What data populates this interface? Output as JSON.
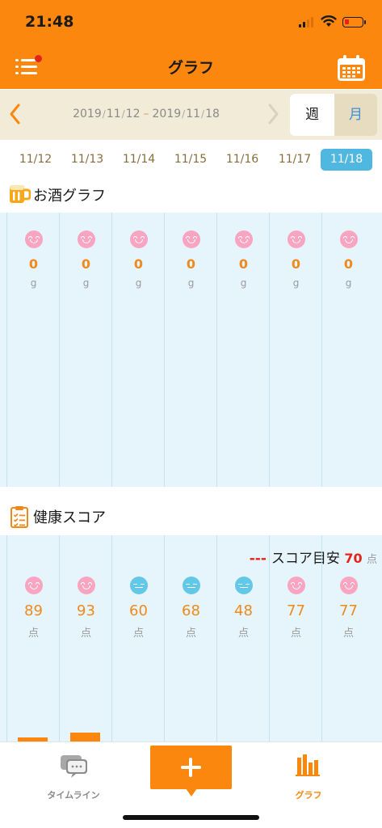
{
  "status": {
    "time": "21:48"
  },
  "header": {
    "title": "グラフ"
  },
  "range": {
    "start": {
      "y": "2019",
      "m": "11",
      "d": "12"
    },
    "end": {
      "y": "2019",
      "m": "11",
      "d": "18"
    },
    "sep": "/",
    "dash": "–"
  },
  "segments": {
    "week": "週",
    "month": "月",
    "selected": "週"
  },
  "days": [
    "11/12",
    "11/13",
    "11/14",
    "11/15",
    "11/16",
    "11/17",
    "11/18"
  ],
  "selected_day": "11/18",
  "alcohol": {
    "title": "お酒グラフ",
    "days": [
      {
        "mood": "happy",
        "value": "0",
        "unit": "g"
      },
      {
        "mood": "happy",
        "value": "0",
        "unit": "g"
      },
      {
        "mood": "happy",
        "value": "0",
        "unit": "g"
      },
      {
        "mood": "happy",
        "value": "0",
        "unit": "g"
      },
      {
        "mood": "happy",
        "value": "0",
        "unit": "g"
      },
      {
        "mood": "happy",
        "value": "0",
        "unit": "g"
      },
      {
        "mood": "happy",
        "value": "0",
        "unit": "g"
      }
    ]
  },
  "health": {
    "title": "健康スコア",
    "target_dashes": "---",
    "target_label": "スコア目安",
    "target_value": "70",
    "target_unit": "点",
    "days": [
      {
        "mood": "happy",
        "value": "89",
        "unit": "点"
      },
      {
        "mood": "happy",
        "value": "93",
        "unit": "点"
      },
      {
        "mood": "neutral",
        "value": "60",
        "unit": "点"
      },
      {
        "mood": "neutral",
        "value": "68",
        "unit": "点"
      },
      {
        "mood": "neutral",
        "value": "48",
        "unit": "点"
      },
      {
        "mood": "happy",
        "value": "77",
        "unit": "点"
      },
      {
        "mood": "happy",
        "value": "77",
        "unit": "点"
      }
    ]
  },
  "tabs": {
    "timeline": "タイムライン",
    "graph": "グラフ",
    "active": "グラフ"
  },
  "colors": {
    "accent": "#fb870f",
    "happy_face": "#f9a4c0",
    "neutral_face": "#62c8e8",
    "panel_bg": "#e6f4fb",
    "selected_day": "#4fb7e0",
    "target_red": "#e5231a",
    "value_orange": "#ee8a1e"
  },
  "icons": {
    "menu": "menu-icon",
    "calendar": "calendar-icon",
    "prev": "chevron-left-icon",
    "next": "chevron-right-icon",
    "beer": "beer-mug-icon",
    "clipboard": "clipboard-icon",
    "timeline": "chat-bubbles-icon",
    "add": "plus-icon",
    "graph": "bar-chart-icon"
  }
}
